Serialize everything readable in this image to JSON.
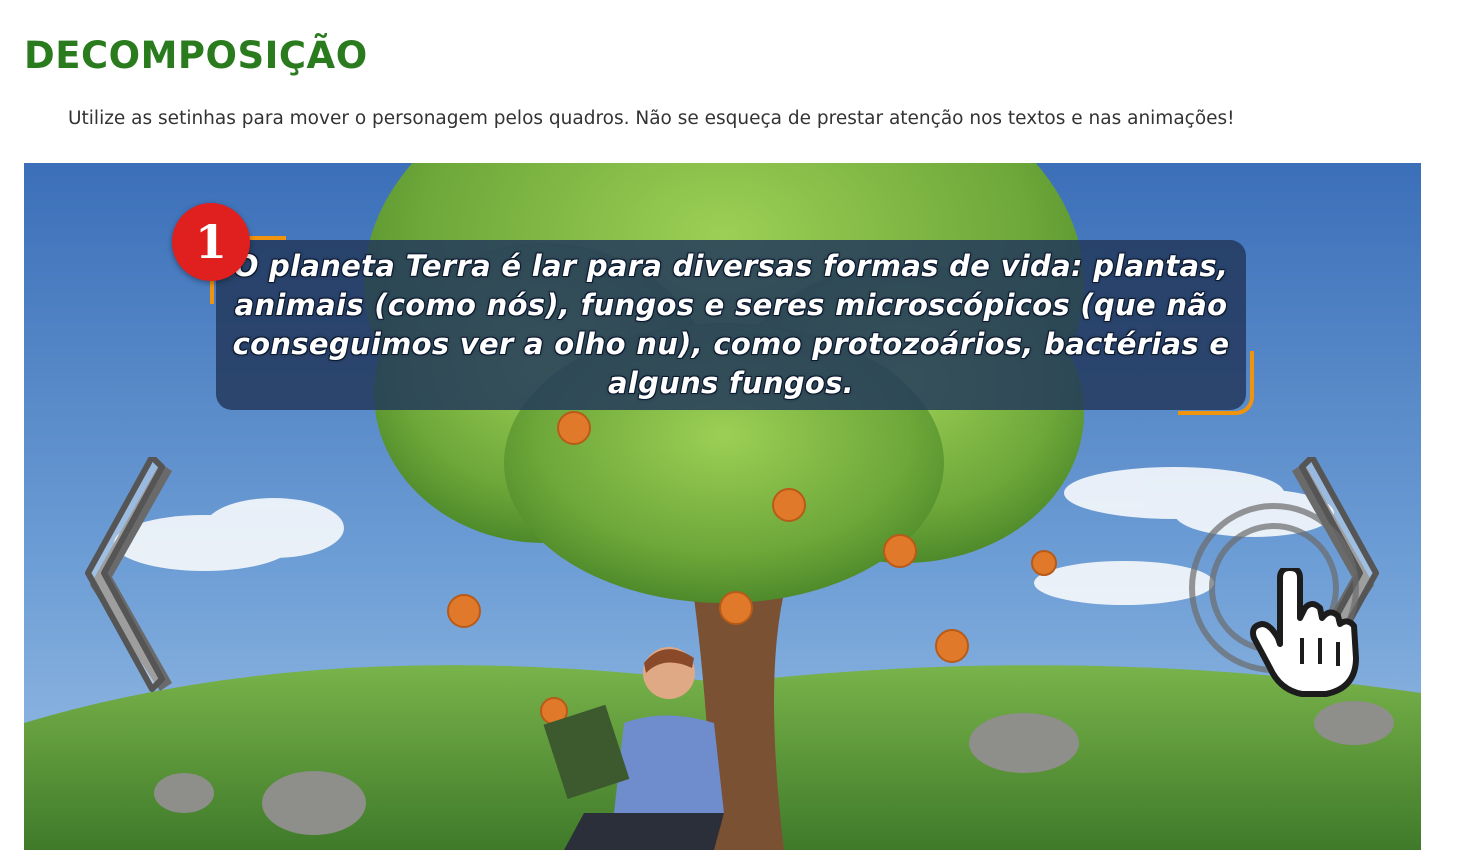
{
  "header": {
    "title": "DECOMPOSIÇÃO",
    "instructions": "Utilize as setinhas para mover o personagem pelos quadros. Não se esqueça de prestar atenção nos textos e nas animações!"
  },
  "stage": {
    "frame_number": "1",
    "narration": "O planeta Terra é lar para diversas formas de vida: plantas, animais (como nós), fungos e seres microscópicos (que não conseguimos ver a olho nu), como protozoários, bactérias e alguns fungos.",
    "prev_icon": "chevron-left-icon",
    "next_icon": "chevron-right-icon",
    "hint_icon": "pointing-hand-icon"
  },
  "colors": {
    "title_green": "#2a7a1e",
    "badge_red": "#e01f1f",
    "accent_orange": "#f0940e",
    "narration_bg": "#22385c",
    "sky_blue": "#4a82c8",
    "grass_green": "#5f9a3a"
  }
}
